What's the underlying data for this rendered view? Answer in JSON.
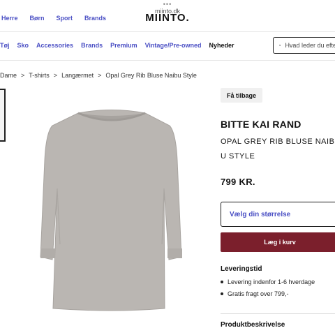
{
  "browser": {
    "dots": "•••",
    "url": "miinto.dk"
  },
  "header": {
    "logo": "MIINTO.",
    "gender_nav": [
      "Herre",
      "Børn",
      "Sport",
      "Brands"
    ]
  },
  "category_nav": {
    "items": [
      "Tøj",
      "Sko",
      "Accessories",
      "Brands",
      "Premium",
      "Vintage/Pre-owned",
      "Nyheder"
    ],
    "active": "Nyheder"
  },
  "search": {
    "placeholder": "Hvad leder du efter?"
  },
  "breadcrumb": [
    "Dame",
    "T-shirts",
    "Langærmet",
    "Opal Grey Rib Bluse Naibu Style"
  ],
  "product": {
    "back_label": "Få tilbage",
    "brand": "BITTE KAI RAND",
    "title": "OPAL GREY RIB BLUSE NAIBU STYLE",
    "price": "799 KR.",
    "size_placeholder": "Vælg din størrelse",
    "add_to_cart": "Læg i kurv",
    "image_color": "#b8b4b0"
  },
  "delivery": {
    "heading": "Leveringstid",
    "items": [
      "Levering indenfor 1-6 hverdage",
      "Gratis fragt over 799,-"
    ]
  },
  "description": {
    "heading": "Produktbeskrivelse"
  },
  "colors": {
    "link": "#4a4fc4",
    "cta": "#7b1f2c"
  }
}
